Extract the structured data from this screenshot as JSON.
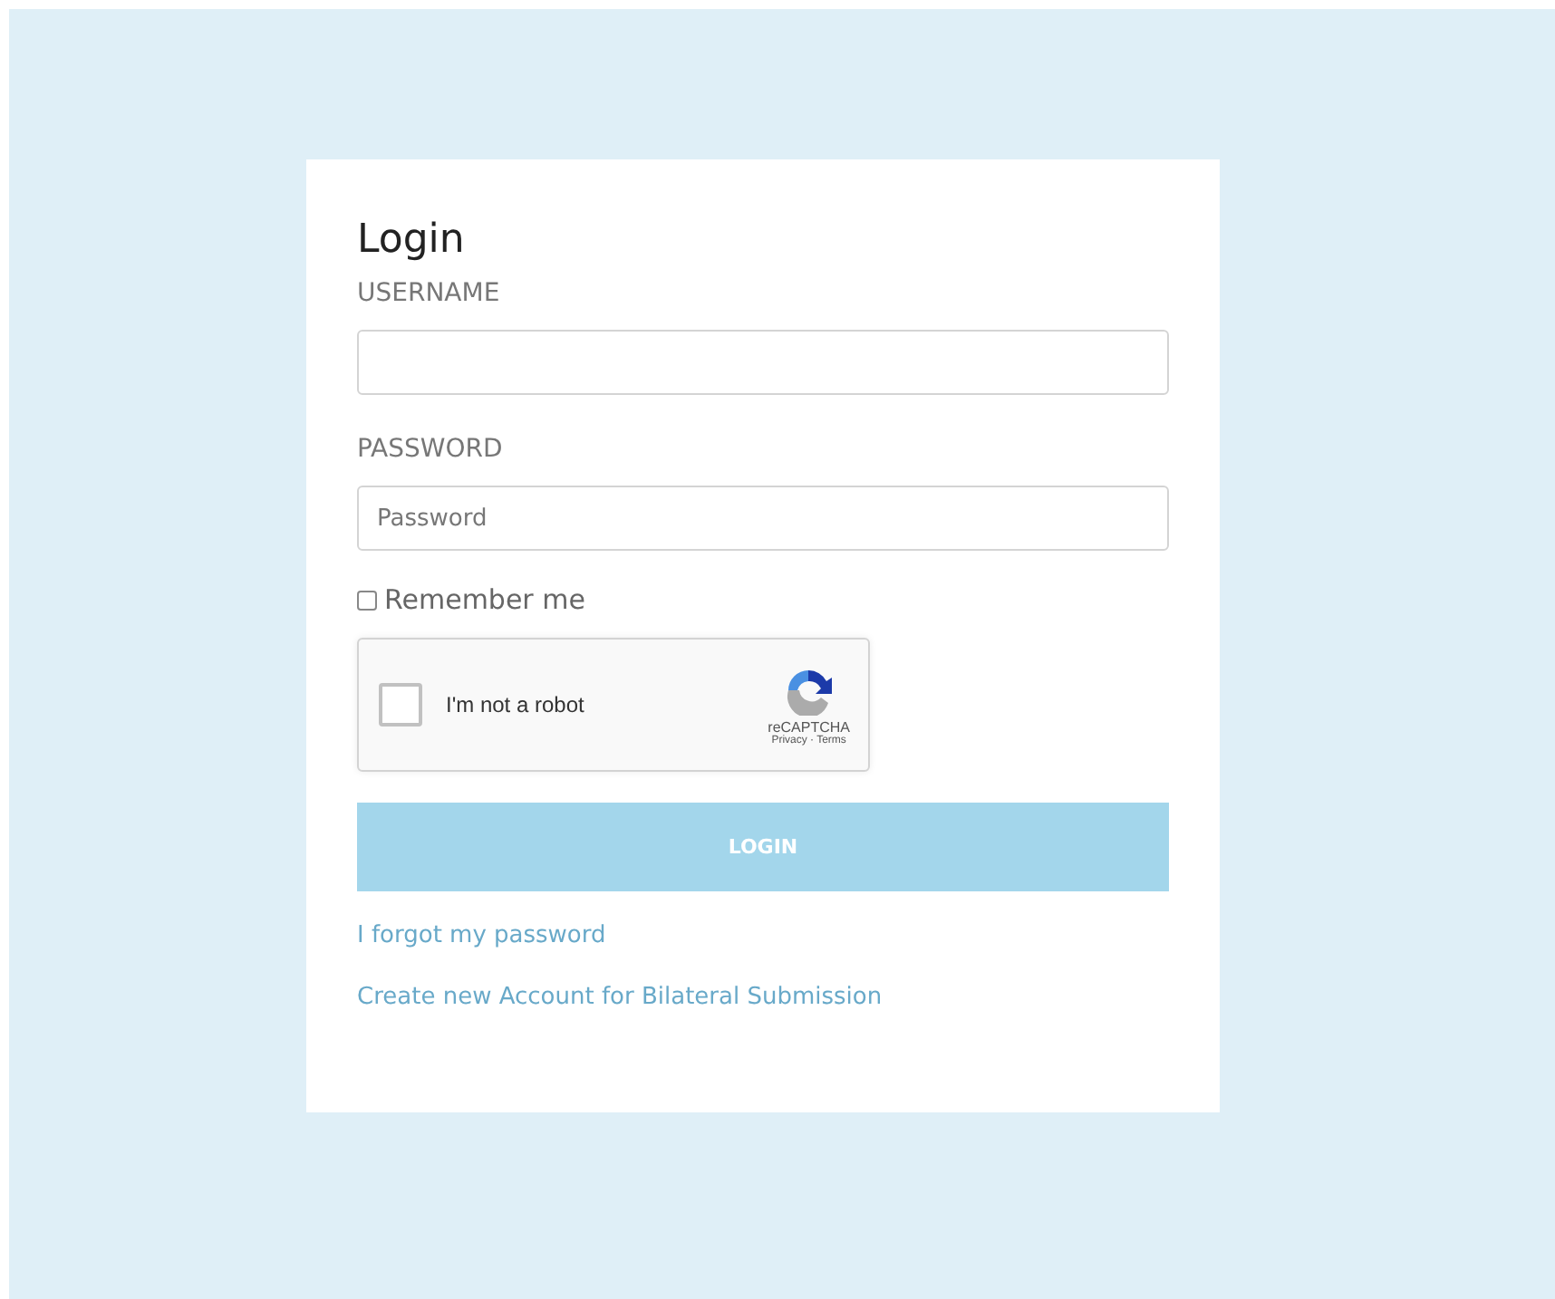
{
  "form": {
    "title": "Login",
    "fields": [
      {
        "label": "USERNAME"
      },
      {
        "label": "PASSWORD",
        "placeholder": "Password"
      }
    ],
    "remember": {
      "label": "Remember me",
      "checked": false
    },
    "captcha": {
      "label": "I'm not a robot",
      "brand": "reCAPTCHA",
      "legal": "Privacy · Terms",
      "checked": false
    },
    "submit": "LOGIN",
    "links": [
      "I forgot my password",
      "Create new Account for Bilateral Submission"
    ]
  }
}
